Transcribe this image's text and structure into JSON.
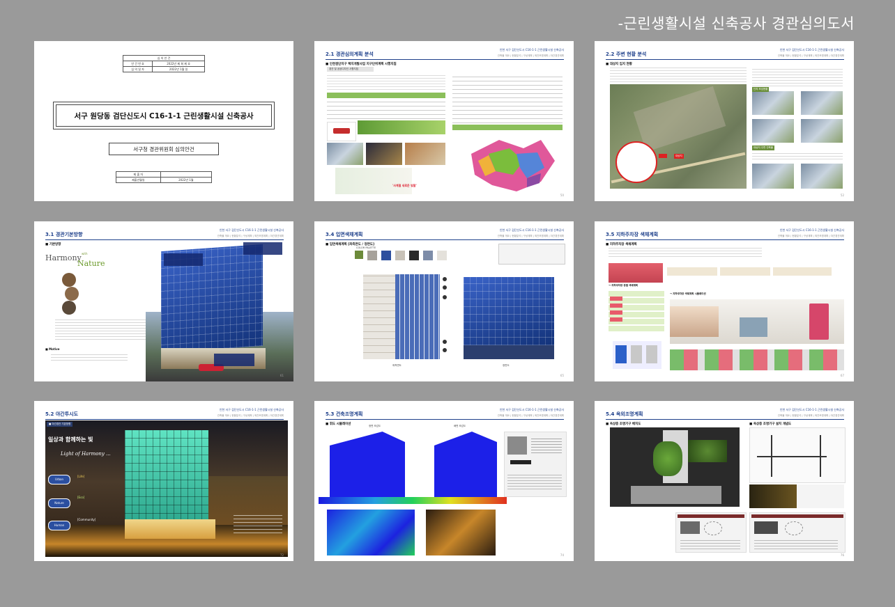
{
  "doc_title": "-근린생활시설 신축공사 경관심의도서",
  "header_small": "인천 서구 검단신도시 C16-1-1 근린생활시설 신축공사",
  "tabs": "건축물 개요 | 현황분석 | 구상계획 | 외관조명계획 | 야간경관계획",
  "cover": {
    "table_header": "심 의 안 건",
    "rows": [
      [
        "안 건 번 호",
        "2022년 제 회 제 호"
      ],
      [
        "심 의 일 자",
        "2022년 1월   일"
      ]
    ],
    "main_title": "서구 원당동 검단신도시 C16-1-1 근린생활시설 신축공사",
    "subtitle": "서구청 경관위원회 심의안건",
    "bottom_rows": [
      [
        "제 출 자",
        ""
      ],
      [
        "제출년월일",
        "2022년 1월"
      ]
    ]
  },
  "slides": [
    {
      "title": "2.1 경관심의계획 분석",
      "page": "50",
      "section": "■ 인천검단지구 택지개발사업 지구단위계획 시행지침",
      "sub": "경관 및 공공디자인 사항지침",
      "banner": "'사계절 새로운 빛깔'"
    },
    {
      "title": "2.2 주변 현황 분석",
      "page": "52",
      "section": "■ 대상지 입지 현황",
      "label_site": "대상지",
      "p1": "단지 조성현황",
      "p2": "대상지 주변 건축물"
    },
    {
      "title": "3.1 경관기본방향",
      "page": "61",
      "section": "■ 기본방향",
      "harmony": "Harmony",
      "with": "with",
      "nature": "Nature",
      "motive": "■ Motive"
    },
    {
      "title": "3.4 입면색채계획",
      "page": "65",
      "section": "■ 입면색채계획 [좌측면도 / 정면도]",
      "palette": "COLOR PALETTE",
      "caption_l": "좌측면도",
      "caption_r": "정면도"
    },
    {
      "title": "3.5 지하주차장 색채계획",
      "page": "67",
      "section": "■ 지하주차장 색채계획",
      "zoning": "→ 지하주차장 층별 색채계획",
      "sim": "→ 지하주차장 색채계획 시뮬레이션"
    },
    {
      "title": "5.2 야간투시도",
      "page": "72",
      "tag": "■ 야간경관 기본방향",
      "headline": "일상과 함께하는 빛",
      "light": "Light of Harmony ...",
      "urban": "Urban",
      "nature_label": "Nature",
      "human": "Human",
      "life": "[Life]",
      "eco": "[Eco]",
      "community": "[Community]"
    },
    {
      "title": "5.3 건축조명계획",
      "page": "74",
      "section": "■ 휘도 시뮬레이션",
      "label_l": "정면 조감도",
      "label_r": "배면 조감도"
    },
    {
      "title": "5.4 옥외조명계획",
      "page": "76",
      "section": "■ 옥상층 조명기구 배치도",
      "section2": "■ 옥상층 조명기구 설치 개념도"
    }
  ],
  "colors": {
    "bg": "#9a9a9a",
    "accent": "#1d3f8a",
    "glass": "#2b50b0"
  }
}
